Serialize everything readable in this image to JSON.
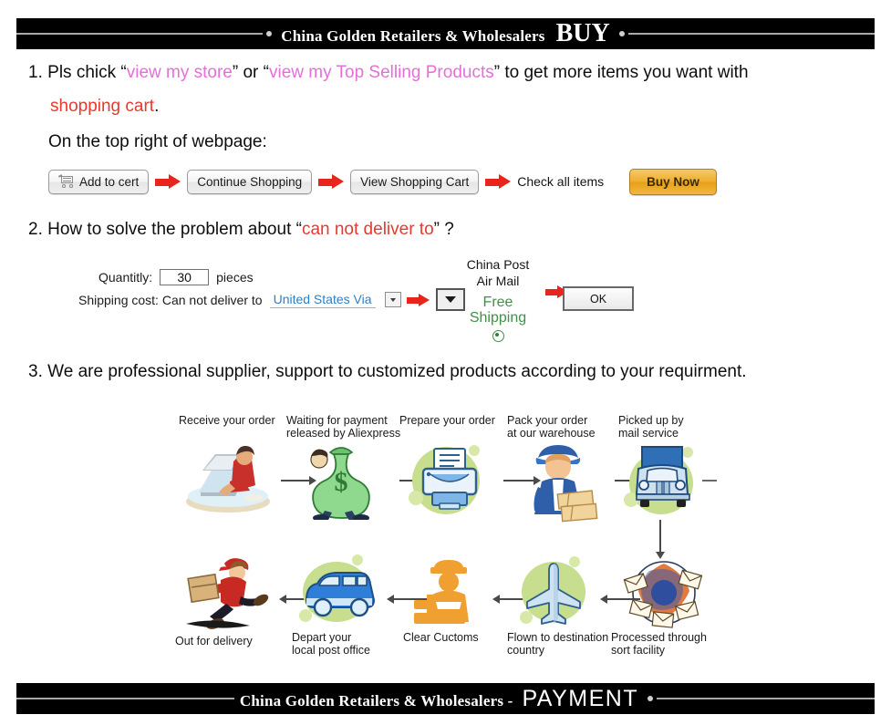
{
  "header": {
    "brand": "China Golden Retailers & Wholesalers",
    "word": "BUY"
  },
  "footer": {
    "brand": "China Golden Retailers & Wholesalers -",
    "word": "PAYMENT"
  },
  "section1": {
    "number": "1.",
    "line1_a": "Pls chick “",
    "line1_link1": "view my store",
    "line1_b": "” or “",
    "line1_link2": "view my Top Selling  Products",
    "line1_c": "” to get more items you want with",
    "line2_link": "shopping cart",
    "line2_tail": ".",
    "line3": "On the top right of webpage:",
    "buttons": {
      "add_to_cart": "Add to cert",
      "continue_shopping": "Continue Shopping",
      "view_cart": "View Shopping Cart",
      "check_all_items": "Check all items",
      "buy_now": "Buy Now"
    }
  },
  "section2": {
    "number": "2.",
    "heading_a": "How to solve the problem about “",
    "heading_red": "can not deliver to",
    "heading_b": "” ?",
    "quantity_label": "Quantitly:",
    "quantity_value": "30",
    "pieces_label": "pieces",
    "shipping_label": "Shipping cost: Can not deliver to",
    "country_value": "United States Via",
    "china_post_line1": "China Post",
    "china_post_line2": "Air Mail",
    "free_shipping_line1": "Free",
    "free_shipping_line2": "Shipping",
    "ok_label": "OK"
  },
  "section3": {
    "number": "3.",
    "heading": "We are professional supplier, support to customized products according to your requirment.",
    "flow_top": [
      {
        "label": "Receive your order",
        "icon": "person-at-laptop-icon"
      },
      {
        "label": "Waiting for payment\nreleased by Aliexpress",
        "icon": "money-bag-icon"
      },
      {
        "label": "Prepare your order",
        "icon": "printer-icon"
      },
      {
        "label": "Pack your order\nat our warehouse",
        "icon": "worker-with-boxes-icon"
      },
      {
        "label": "Picked up by\nmail service",
        "icon": "truck-icon"
      }
    ],
    "flow_bottom": [
      {
        "label": "Out for delivery",
        "icon": "courier-running-icon"
      },
      {
        "label": "Depart your\nlocal post office",
        "icon": "delivery-van-icon"
      },
      {
        "label": "Clear Cuctoms",
        "icon": "customs-officer-icon"
      },
      {
        "label": "Flown to destination\ncountry",
        "icon": "airplane-icon"
      },
      {
        "label": "Processed through\nsort facility",
        "icon": "mail-sorting-icon"
      }
    ]
  },
  "colors": {
    "banner_bg": "#000000",
    "pink": "#e46fd9",
    "red": "#e8392e",
    "arrow_red": "#e8241c",
    "link_blue": "#2f7fc4",
    "free_green": "#3f9147",
    "buy_now_gold": "#efae31",
    "blob_green": "#c6de8e"
  }
}
